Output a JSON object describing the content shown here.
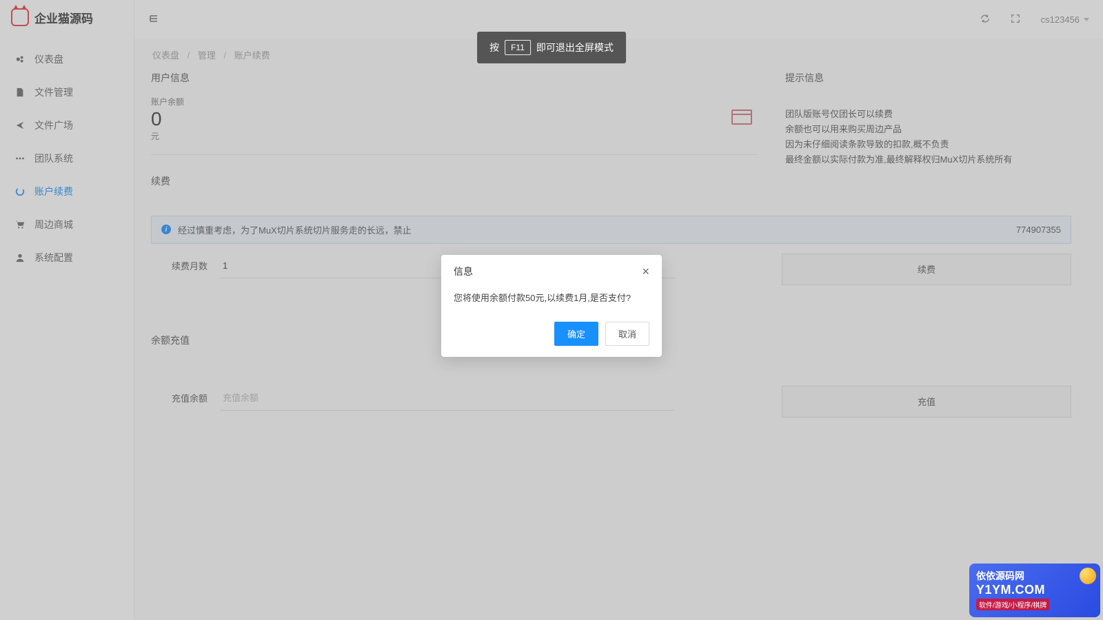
{
  "logo": {
    "text": "企业猫源码"
  },
  "sidebar": {
    "items": [
      {
        "label": "仪表盘",
        "icon": "dashboard"
      },
      {
        "label": "文件管理",
        "icon": "file"
      },
      {
        "label": "文件广场",
        "icon": "share"
      },
      {
        "label": "团队系统",
        "icon": "dots"
      },
      {
        "label": "账户续费",
        "icon": "spinner"
      },
      {
        "label": "周边商城",
        "icon": "cart"
      },
      {
        "label": "系统配置",
        "icon": "user"
      }
    ],
    "activeIndex": 4
  },
  "topbar": {
    "username": "cs123456"
  },
  "breadcrumb": {
    "items": [
      "仪表盘",
      "管理",
      "账户续费"
    ]
  },
  "user_info": {
    "section_title": "用户信息",
    "balance_label": "账户余额",
    "balance_value": "0",
    "balance_unit": "元"
  },
  "tips": {
    "title": "提示信息",
    "lines": [
      "团队版账号仅团长可以续费",
      "余额也可以用来购买周边产品",
      "因为未仔细阅读条款导致的扣款,概不负责",
      "最终金额以实际付款为准,最终解释权归MuX切片系统所有"
    ]
  },
  "renewal": {
    "section_title": "续费",
    "alert_prefix": "经过慎重考虑，为了MuX切片系统切片服务走的长远，禁止",
    "alert_suffix": "774907355",
    "months_label": "续费月数",
    "months_value": "1",
    "renew_button": "续费"
  },
  "recharge": {
    "section_title": "余额充值",
    "amount_label": "充值余额",
    "amount_placeholder": "充值余额",
    "recharge_button": "充值"
  },
  "modal": {
    "title": "信息",
    "body": "您将使用余额付款50元,以续费1月,是否支付?",
    "ok": "确定",
    "cancel": "取消"
  },
  "fullscreen_toast": {
    "prefix": "按",
    "key": "F11",
    "suffix": "即可退出全屏模式"
  },
  "watermark": {
    "title": "依依源码网",
    "domain": "Y1YM.COM",
    "tags": "软件/游戏/小程序/棋牌"
  }
}
